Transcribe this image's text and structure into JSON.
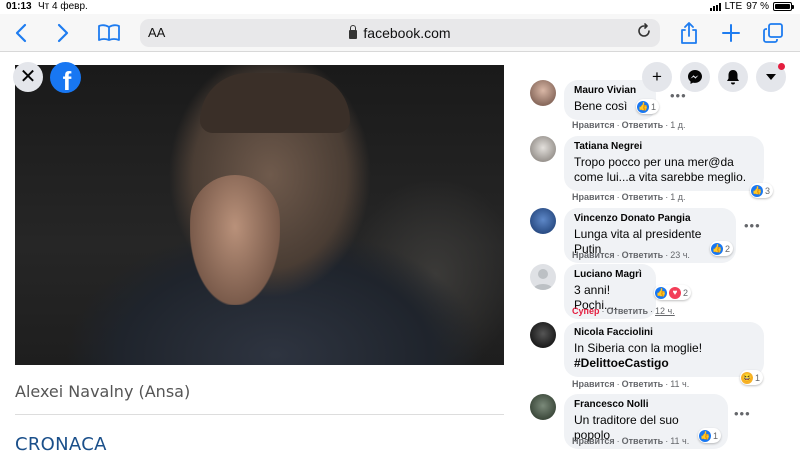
{
  "status": {
    "time": "01:13",
    "date": "Чт 4 февр.",
    "network": "LTE",
    "battery": "97 %",
    "battery_level": 0.97
  },
  "browser": {
    "aa_label": "AA",
    "url": "facebook.com"
  },
  "viewer": {
    "caption": "Alexei Navalny (Ansa)",
    "section": "CRONACA"
  },
  "actions": [
    "plus-icon",
    "messenger-icon",
    "notifications-icon",
    "account-menu-icon"
  ],
  "comments": [
    {
      "name": "Mauro Vivian",
      "text": "Bene così",
      "reactions": {
        "icons": [
          "like"
        ],
        "count": "1"
      },
      "like_label": "Нравится",
      "reply_label": "Ответить",
      "time": "1 д."
    },
    {
      "name": "Tatiana Negrei",
      "text_line1": "Tropo pocco per una mer@da",
      "text_line2": "come lui...a vita sarebbe meglio.",
      "reactions": {
        "icons": [
          "like"
        ],
        "count": "3"
      },
      "like_label": "Нравится",
      "reply_label": "Ответить",
      "time": "1 д."
    },
    {
      "name": "Vincenzo Donato Pangia",
      "text": "Lunga vita al presidente Putin",
      "reactions": {
        "icons": [
          "like"
        ],
        "count": "2"
      },
      "like_label": "Нравится",
      "reply_label": "Ответить",
      "time": "23 ч."
    },
    {
      "name": "Luciano Magrì",
      "text": "3 anni! Pochi....",
      "reactions": {
        "icons": [
          "like",
          "love"
        ],
        "count": "2"
      },
      "like_label": "Супер",
      "reply_label": "Ответить",
      "time": "12 ч."
    },
    {
      "name": "Nicola Facciolini",
      "text_line1": "In Siberia con la moglie!",
      "hashtag": "#DelittoeCastigo",
      "reactions": {
        "icons": [
          "haha"
        ],
        "count": "1"
      },
      "like_label": "Нравится",
      "reply_label": "Ответить",
      "time": "11 ч."
    },
    {
      "name": "Francesco Nolli",
      "text": "Un traditore del suo popolo",
      "reactions": {
        "icons": [
          "like"
        ],
        "count": "1"
      },
      "like_label": "Нравится",
      "reply_label": "Ответить",
      "time": "11 ч."
    }
  ],
  "colors": {
    "facebook_blue": "#1877f2",
    "ios_blue": "#1e7cf0",
    "super_red": "#e41e3f",
    "section_blue": "#1a4f8a"
  }
}
